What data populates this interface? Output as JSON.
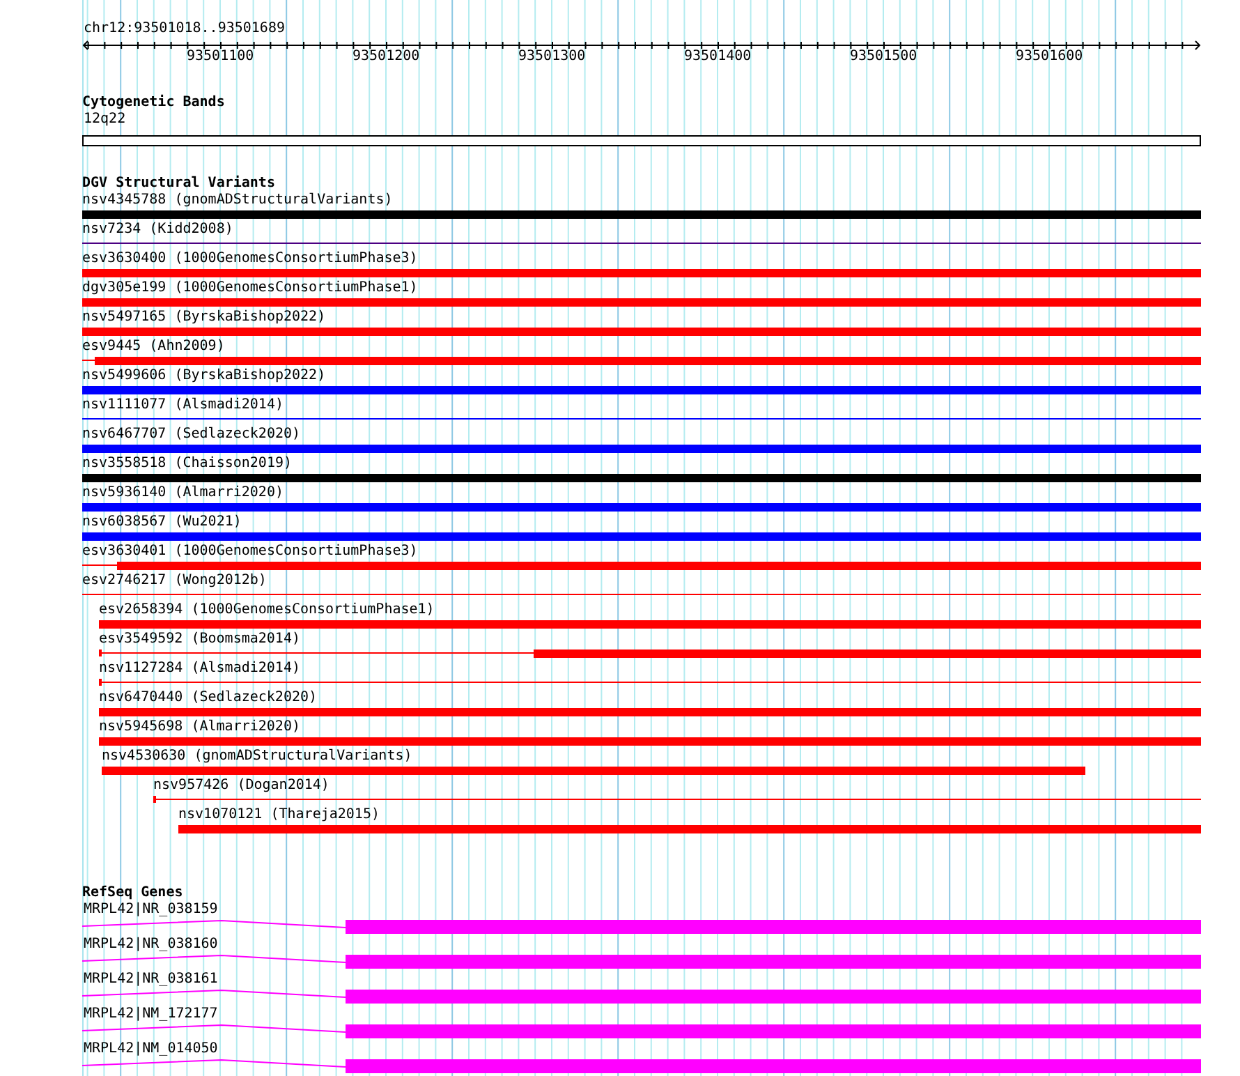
{
  "ruler": {
    "location": "chr12:93501018..93501689",
    "ticks": [
      "93501100",
      "93501200",
      "93501300",
      "93501400",
      "93501500",
      "93501600"
    ]
  },
  "cytogenetic_bands": {
    "title": "Cytogenetic Bands",
    "features": [
      {
        "label": "12q22"
      }
    ]
  },
  "dgv_structural_variants": {
    "title": "DGV Structural Variants",
    "features": [
      {
        "label": "nsv4345788 (gnomADStructuralVariants)",
        "kind": "thick",
        "color": "#000000"
      },
      {
        "label": "nsv7234 (Kidd2008)",
        "kind": "thin",
        "color": "#4b0082"
      },
      {
        "label": "esv3630400 (1000GenomesConsortiumPhase3)",
        "kind": "thick",
        "color": "#ff0000"
      },
      {
        "label": "dgv305e199 (1000GenomesConsortiumPhase1)",
        "kind": "thick",
        "color": "#ff0000"
      },
      {
        "label": "nsv5497165 (ByrskaBishop2022)",
        "kind": "thick",
        "color": "#ff0000"
      },
      {
        "label": "esv9445 (Ahn2009)",
        "kind": "split",
        "color": "#ff0000"
      },
      {
        "label": "nsv5499606 (ByrskaBishop2022)",
        "kind": "thick",
        "color": "#0000ff"
      },
      {
        "label": "nsv1111077 (Alsmadi2014)",
        "kind": "thin",
        "color": "#0000ff"
      },
      {
        "label": "nsv6467707 (Sedlazeck2020)",
        "kind": "thick",
        "color": "#0000ff"
      },
      {
        "label": "nsv3558518 (Chaisson2019)",
        "kind": "thick",
        "color": "#000000"
      },
      {
        "label": "nsv5936140 (Almarri2020)",
        "kind": "thick",
        "color": "#0000ff"
      },
      {
        "label": "nsv6038567 (Wu2021)",
        "kind": "thick",
        "color": "#0000ff"
      },
      {
        "label": "esv3630401 (1000GenomesConsortiumPhase3)",
        "kind": "split",
        "color": "#ff0000"
      },
      {
        "label": "esv2746217 (Wong2012b)",
        "kind": "thin",
        "color": "#ff0000"
      },
      {
        "label": "esv2658394 (1000GenomesConsortiumPhase1)",
        "kind": "thick",
        "color": "#ff0000"
      },
      {
        "label": "esv3549592 (Boomsma2014)",
        "kind": "split",
        "color": "#ff0000"
      },
      {
        "label": "nsv1127284 (Alsmadi2014)",
        "kind": "thin",
        "color": "#ff0000"
      },
      {
        "label": "nsv6470440 (Sedlazeck2020)",
        "kind": "thick",
        "color": "#ff0000"
      },
      {
        "label": "nsv5945698 (Almarri2020)",
        "kind": "thick",
        "color": "#ff0000"
      },
      {
        "label": "nsv4530630 (gnomADStructuralVariants)",
        "kind": "thick",
        "color": "#ff0000"
      },
      {
        "label": "nsv957426 (Dogan2014)",
        "kind": "thin",
        "color": "#ff0000"
      },
      {
        "label": "nsv1070121 (Thareja2015)",
        "kind": "thick",
        "color": "#ff0000"
      }
    ]
  },
  "refseq_genes": {
    "title": "RefSeq Genes",
    "features": [
      {
        "label": "MRPL42|NR_038159"
      },
      {
        "label": "MRPL42|NR_038160"
      },
      {
        "label": "MRPL42|NR_038161"
      },
      {
        "label": "MRPL42|NM_172177"
      },
      {
        "label": "MRPL42|NM_014050"
      }
    ]
  }
}
